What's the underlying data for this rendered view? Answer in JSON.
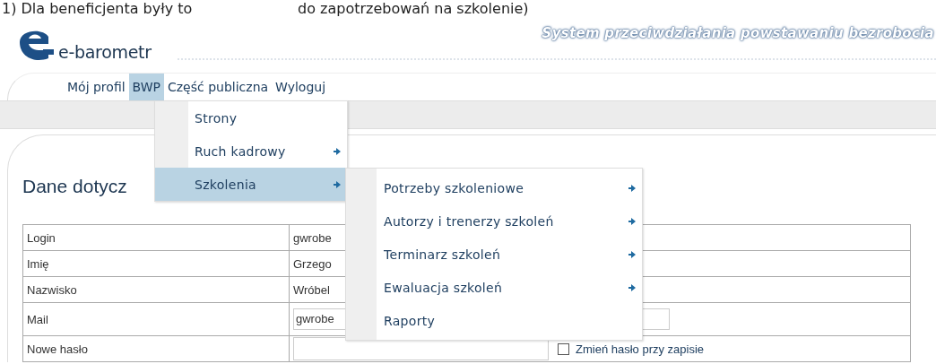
{
  "document_text": [
    "1) Dla beneficjenta były to",
    "do zapotrzebowań na szkolenie)"
  ],
  "header": {
    "logo_text": "e-barometr",
    "tagline": "System przeciwdziałania powstawaniu bezrobocia"
  },
  "nav": [
    {
      "label": "Mój profil",
      "selected": false
    },
    {
      "label": "BWP",
      "selected": true
    },
    {
      "label": "Część publiczna",
      "selected": false
    },
    {
      "label": "Wyloguj",
      "selected": false
    }
  ],
  "menu": [
    {
      "label": "Strony",
      "selected": false,
      "has_submenu": false
    },
    {
      "label": "Ruch kadrowy",
      "selected": false,
      "has_submenu": true
    },
    {
      "label": "Szkolenia",
      "selected": true,
      "has_submenu": true
    }
  ],
  "submenu": [
    {
      "label": "Potrzeby szkoleniowe",
      "selected": false,
      "has_submenu": true
    },
    {
      "label": "Autorzy i trenerzy szkoleń",
      "selected": false,
      "has_submenu": true
    },
    {
      "label": "Terminarz szkoleń",
      "selected": false,
      "has_submenu": true
    },
    {
      "label": "Ewaluacja szkoleń",
      "selected": false,
      "has_submenu": true
    },
    {
      "label": "Raporty",
      "selected": false,
      "has_submenu": false
    }
  ],
  "section_title": "Dane dotycz",
  "form": [
    {
      "label": "Login",
      "kind": "text",
      "value": "gwrobe"
    },
    {
      "label": "Imię",
      "kind": "text",
      "value": "Grzego"
    },
    {
      "label": "Nazwisko",
      "kind": "text",
      "value": "Wróbel"
    },
    {
      "label": "Mail",
      "kind": "input",
      "value": "gwrobe"
    },
    {
      "label": "Nowe hasło",
      "kind": "password",
      "checkbox": {
        "label": "Zmień hasło przy zapisie",
        "checked": false
      }
    }
  ]
}
